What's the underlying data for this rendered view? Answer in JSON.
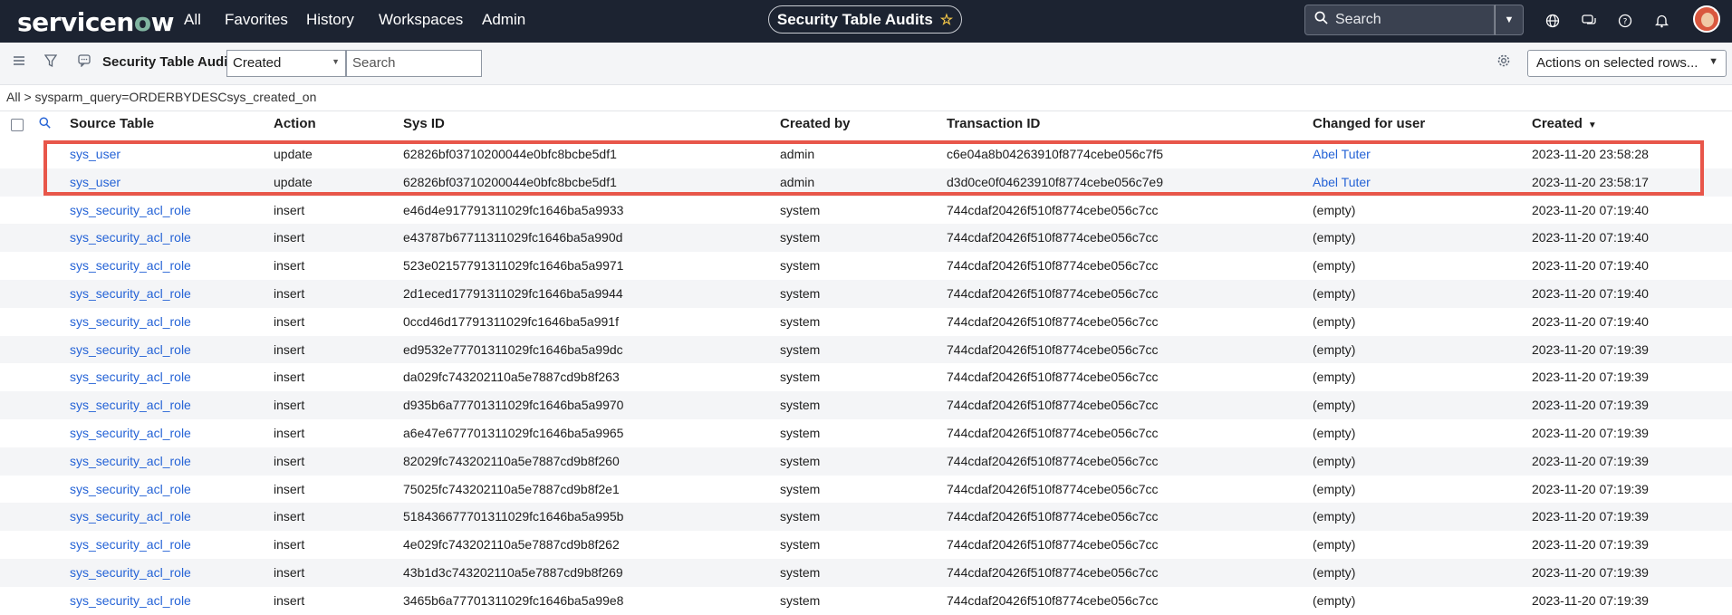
{
  "brand": {
    "name_a": "servicen",
    "name_o": "o",
    "name_b": "w"
  },
  "topnav": {
    "links": [
      "All",
      "Favorites",
      "History",
      "Workspaces",
      "Admin"
    ],
    "page_title": "Security Table Audits",
    "search_placeholder": "Search"
  },
  "listbar": {
    "title": "Security Table Audits",
    "field_select": "Created",
    "search_placeholder": "Search",
    "actions_label": "Actions on selected rows..."
  },
  "breadcrumb": "All > sysparm_query=ORDERBYDESCsys_created_on",
  "columns": [
    "Source Table",
    "Action",
    "Sys ID",
    "Created by",
    "Transaction ID",
    "Changed for user",
    "Created"
  ],
  "rows": [
    [
      "sys_user",
      "update",
      "62826bf03710200044e0bfc8bcbe5df1",
      "admin",
      "c6e04a8b04263910f8774cebe056c7f5",
      "Abel Tuter",
      "2023-11-20 23:58:28"
    ],
    [
      "sys_user",
      "update",
      "62826bf03710200044e0bfc8bcbe5df1",
      "admin",
      "d3d0ce0f04623910f8774cebe056c7e9",
      "Abel Tuter",
      "2023-11-20 23:58:17"
    ],
    [
      "sys_security_acl_role",
      "insert",
      "e46d4e917791311029fc1646ba5a9933",
      "system",
      "744cdaf20426f510f8774cebe056c7cc",
      "(empty)",
      "2023-11-20 07:19:40"
    ],
    [
      "sys_security_acl_role",
      "insert",
      "e43787b67711311029fc1646ba5a990d",
      "system",
      "744cdaf20426f510f8774cebe056c7cc",
      "(empty)",
      "2023-11-20 07:19:40"
    ],
    [
      "sys_security_acl_role",
      "insert",
      "523e02157791311029fc1646ba5a9971",
      "system",
      "744cdaf20426f510f8774cebe056c7cc",
      "(empty)",
      "2023-11-20 07:19:40"
    ],
    [
      "sys_security_acl_role",
      "insert",
      "2d1eced17791311029fc1646ba5a9944",
      "system",
      "744cdaf20426f510f8774cebe056c7cc",
      "(empty)",
      "2023-11-20 07:19:40"
    ],
    [
      "sys_security_acl_role",
      "insert",
      "0ccd46d17791311029fc1646ba5a991f",
      "system",
      "744cdaf20426f510f8774cebe056c7cc",
      "(empty)",
      "2023-11-20 07:19:40"
    ],
    [
      "sys_security_acl_role",
      "insert",
      "ed9532e77701311029fc1646ba5a99dc",
      "system",
      "744cdaf20426f510f8774cebe056c7cc",
      "(empty)",
      "2023-11-20 07:19:39"
    ],
    [
      "sys_security_acl_role",
      "insert",
      "da029fc743202110a5e7887cd9b8f263",
      "system",
      "744cdaf20426f510f8774cebe056c7cc",
      "(empty)",
      "2023-11-20 07:19:39"
    ],
    [
      "sys_security_acl_role",
      "insert",
      "d935b6a77701311029fc1646ba5a9970",
      "system",
      "744cdaf20426f510f8774cebe056c7cc",
      "(empty)",
      "2023-11-20 07:19:39"
    ],
    [
      "sys_security_acl_role",
      "insert",
      "a6e47e677701311029fc1646ba5a9965",
      "system",
      "744cdaf20426f510f8774cebe056c7cc",
      "(empty)",
      "2023-11-20 07:19:39"
    ],
    [
      "sys_security_acl_role",
      "insert",
      "82029fc743202110a5e7887cd9b8f260",
      "system",
      "744cdaf20426f510f8774cebe056c7cc",
      "(empty)",
      "2023-11-20 07:19:39"
    ],
    [
      "sys_security_acl_role",
      "insert",
      "75025fc743202110a5e7887cd9b8f2e1",
      "system",
      "744cdaf20426f510f8774cebe056c7cc",
      "(empty)",
      "2023-11-20 07:19:39"
    ],
    [
      "sys_security_acl_role",
      "insert",
      "518436677701311029fc1646ba5a995b",
      "system",
      "744cdaf20426f510f8774cebe056c7cc",
      "(empty)",
      "2023-11-20 07:19:39"
    ],
    [
      "sys_security_acl_role",
      "insert",
      "4e029fc743202110a5e7887cd9b8f262",
      "system",
      "744cdaf20426f510f8774cebe056c7cc",
      "(empty)",
      "2023-11-20 07:19:39"
    ],
    [
      "sys_security_acl_role",
      "insert",
      "43b1d3c743202110a5e7887cd9b8f269",
      "system",
      "744cdaf20426f510f8774cebe056c7cc",
      "(empty)",
      "2023-11-20 07:19:39"
    ],
    [
      "sys_security_acl_role",
      "insert",
      "3465b6a77701311029fc1646ba5a99e8",
      "system",
      "744cdaf20426f510f8774cebe056c7cc",
      "(empty)",
      "2023-11-20 07:19:39"
    ]
  ],
  "colors": {
    "nav_bg": "#1c2331",
    "link": "#2563d6",
    "highlight": "#e8564a",
    "brand_o": "#81b5a1"
  },
  "icons": [
    "search-icon",
    "star-icon",
    "globe-icon",
    "chat-icon",
    "help-icon",
    "bell-icon",
    "menu-icon",
    "filter-icon",
    "comment-icon",
    "gear-icon"
  ]
}
